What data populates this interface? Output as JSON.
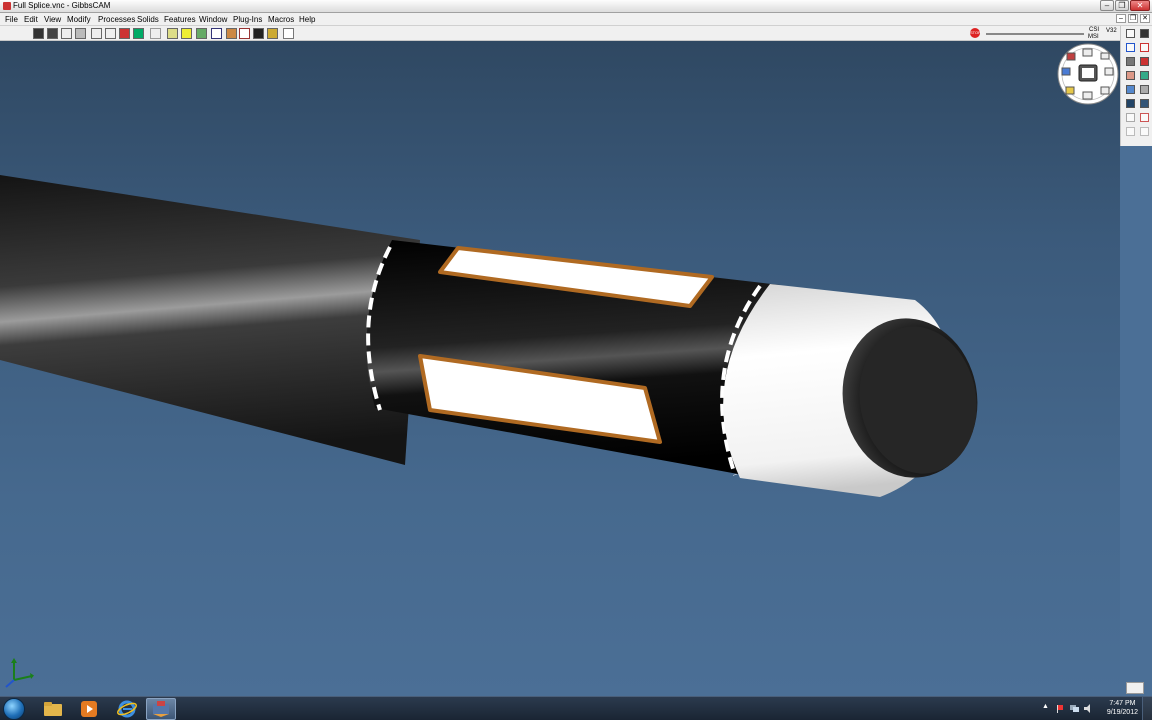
{
  "window": {
    "title": "Full Splice.vnc - GibbsCAM",
    "min_glyph": "–",
    "max_glyph": "❐",
    "close_glyph": "✕"
  },
  "menu": {
    "items": [
      "File",
      "Edit",
      "View",
      "Modify",
      "Processes",
      "Solids",
      "Features",
      "Window",
      "Plug-Ins",
      "Macros",
      "Help"
    ]
  },
  "toolbar": {
    "stop_label": "STOP",
    "csi_label": "CSI",
    "v32_label": "V32",
    "msi_label": "MSI"
  },
  "viewport": {
    "background_color": "#46698e",
    "shaft_color": "#1e1e1e",
    "band_color": "#050505",
    "window_fill": "#ffffff",
    "window_border": "#b06a22",
    "tip_color": "#f5f5f5",
    "cap_color": "#232323"
  },
  "axis_triad": {
    "x_color": "#1a7f1a",
    "y_color": "#1a7f1a",
    "z_color": "#2255cc"
  },
  "taskbar": {
    "apps": [
      "folder-icon",
      "media-player-icon",
      "internet-explorer-icon",
      "gibbscam-icon"
    ],
    "time": "7:47 PM",
    "date": "9/19/2012",
    "tray_arrow": "▲"
  }
}
